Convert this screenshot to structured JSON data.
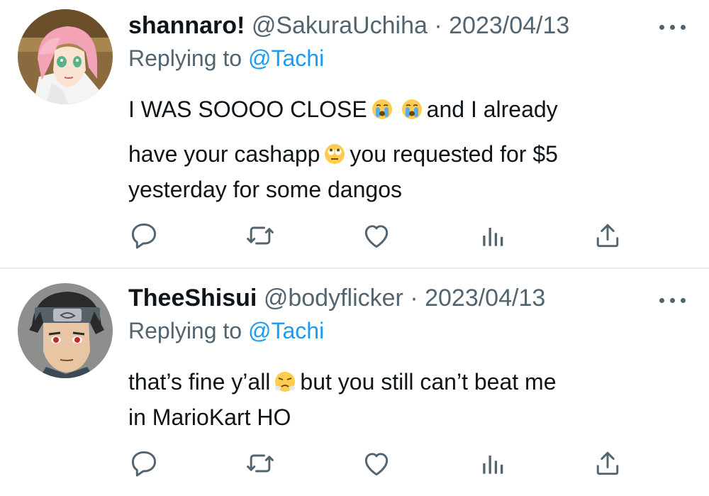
{
  "colors": {
    "text": "#0f1419",
    "secondary": "#536471",
    "accent": "#1d9bf0",
    "divider": "#e7e9ea"
  },
  "tweets": [
    {
      "display_name": "shannaro!",
      "handle": "@SakuraUchiha",
      "separator": "·",
      "date": "2023/04/13",
      "replying_prefix": "Replying to",
      "replying_to": "@Tachi",
      "avatar_icon": "pink-hair-character-avatar",
      "lines": [
        {
          "a": "I WAS SOOOO CLOSE",
          "emoji": [
            "loudly-crying-face",
            "loudly-crying-face"
          ],
          "b": "and I already"
        },
        {
          "a": "have your cashapp",
          "emoji": [
            "face-with-rolling-eyes"
          ],
          "b": "you requested for $5"
        },
        {
          "a": "yesterday for some dangos"
        }
      ]
    },
    {
      "display_name": "TheeShisui",
      "handle": "@bodyflicker",
      "separator": "·",
      "date": "2023/04/13",
      "replying_prefix": "Replying to",
      "replying_to": "@Tachi",
      "avatar_icon": "headband-character-avatar",
      "lines": [
        {
          "a": "that’s fine y’all",
          "emoji": [
            "face-with-steam-from-nose"
          ],
          "b": "but you still can’t beat me"
        },
        {
          "a": "in MarioKart HO"
        }
      ]
    }
  ],
  "action_icons": [
    "reply-icon",
    "retweet-icon",
    "like-icon",
    "views-icon",
    "share-icon"
  ]
}
